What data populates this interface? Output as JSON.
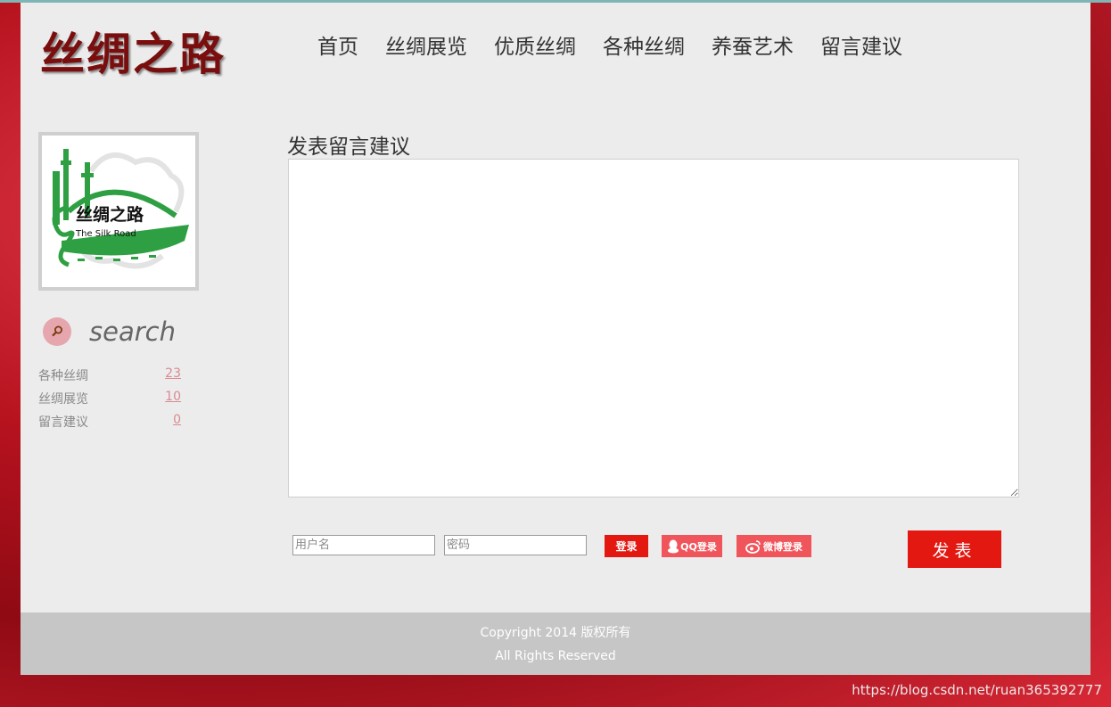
{
  "header": {
    "logo_text": "丝绸之路",
    "nav": [
      "首页",
      "丝绸展览",
      "优质丝绸",
      "各种丝绸",
      "养蚕艺术",
      "留言建议"
    ]
  },
  "sidebar": {
    "logo": {
      "title": "丝绸之路",
      "subtitle": "The Silk Road"
    },
    "search_label": "search",
    "categories": [
      {
        "name": "各种丝绸",
        "count": "23"
      },
      {
        "name": "丝绸展览",
        "count": "10"
      },
      {
        "name": "留言建议",
        "count": "0"
      }
    ]
  },
  "form": {
    "title": "发表留言建议",
    "message_value": "",
    "username_placeholder": "用户名",
    "password_placeholder": "密码",
    "login_label": "登录",
    "qq_login_label": "QQ登录",
    "weibo_login_label": "微博登录",
    "submit_label": "发表"
  },
  "footer": {
    "line1": "Copyright 2014 版权所有",
    "line2": "All Rights Reserved"
  },
  "watermark": "https://blog.csdn.net/ruan365392777",
  "colors": {
    "accent_red": "#e21811",
    "social_red": "#f0555b",
    "logo_green": "#2ea043",
    "logo_dark_red": "#7a0d0d"
  }
}
